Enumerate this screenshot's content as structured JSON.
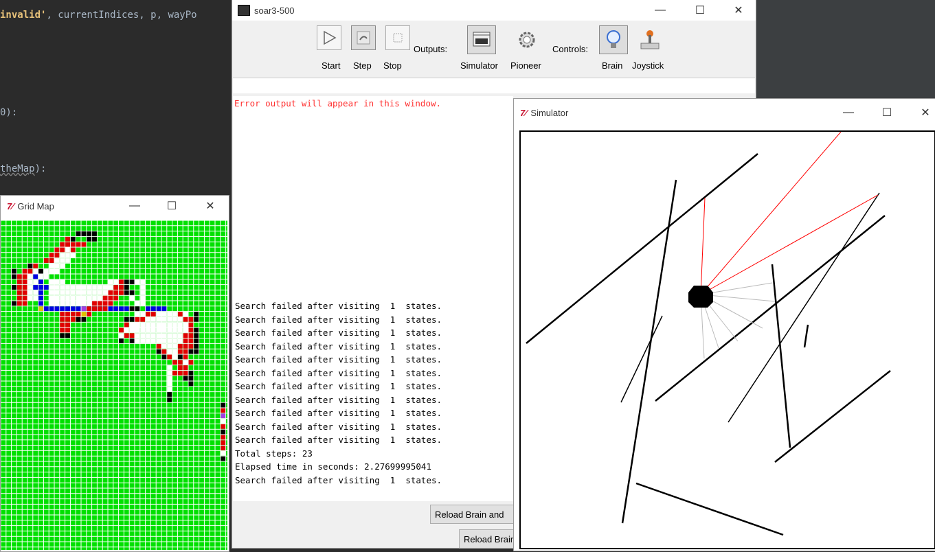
{
  "editor": {
    "line1_prefix": "invalid'",
    "line1_rest": ", currentIndices, p, wayPo",
    "line2": "0):",
    "line3": "theMap",
    "line3_suffix": "):"
  },
  "soar": {
    "title": "soar3-500",
    "buttons": {
      "start": "Start",
      "step": "Step",
      "stop": "Stop",
      "outputs_label": "Outputs:",
      "simulator": "Simulator",
      "pioneer": "Pioneer",
      "controls_label": "Controls:",
      "brain": "Brain",
      "joystick": "Joystick"
    },
    "error_text": "Error output will appear in this window.",
    "log": [
      "Search failed after visiting  1  states.",
      "Search failed after visiting  1  states.",
      "Search failed after visiting  1  states.",
      "Search failed after visiting  1  states.",
      "Search failed after visiting  1  states.",
      "Search failed after visiting  1  states.",
      "Search failed after visiting  1  states.",
      "Search failed after visiting  1  states.",
      "Search failed after visiting  1  states.",
      "Search failed after visiting  1  states.",
      "Search failed after visiting  1  states.",
      "Total steps: 23",
      "Elapsed time in seconds: 2.27699995041",
      "Search failed after visiting  1  states."
    ],
    "reload_brain_and": "Reload Brain and",
    "reload_brain": "Reload Brain"
  },
  "gridmap": {
    "title": "Grid Map"
  },
  "simulator": {
    "title": "Simulator"
  },
  "colors": {
    "grid_green": "#00e000",
    "grid_red": "#e00000",
    "grid_blue": "#0000e0",
    "grid_black": "#000000",
    "grid_white": "#ffffff",
    "grid_purple": "#a040e0",
    "grid_yellow": "#e0c000",
    "error_red": "#ff3030",
    "sonar_red": "#ff0000"
  }
}
